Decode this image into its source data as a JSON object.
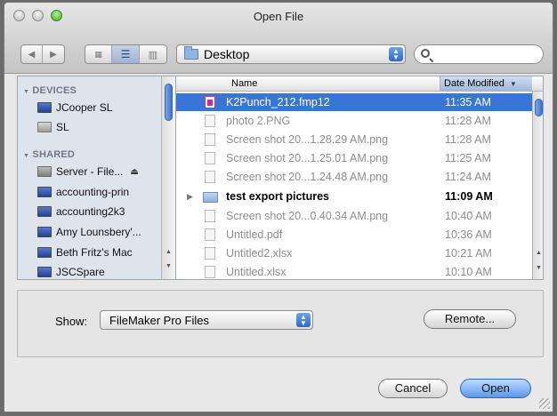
{
  "window": {
    "title": "Open File"
  },
  "toolbar": {
    "back_icon": "back-arrow-icon",
    "forward_icon": "forward-arrow-icon",
    "view_modes": [
      "icon-view-icon",
      "list-view-icon",
      "column-view-icon"
    ],
    "active_view": "list",
    "location": "Desktop",
    "search_value": ""
  },
  "sidebar": {
    "devices_label": "DEVICES",
    "shared_label": "SHARED",
    "devices": [
      {
        "label": "JCooper SL",
        "icon": "computer-icon"
      },
      {
        "label": "SL",
        "icon": "hard-drive-icon"
      }
    ],
    "shared": [
      {
        "label": "Server - File...",
        "icon": "server-icon",
        "eject": "⏏"
      },
      {
        "label": "accounting-prin",
        "icon": "monitor-icon"
      },
      {
        "label": "accounting2k3",
        "icon": "monitor-icon"
      },
      {
        "label": "Amy Lounsbery'...",
        "icon": "computer-icon"
      },
      {
        "label": "Beth Fritz's Mac",
        "icon": "computer-icon"
      },
      {
        "label": "JSCSpare",
        "icon": "computer-icon"
      }
    ]
  },
  "filelist": {
    "columns": {
      "name": "Name",
      "date": "Date Modified"
    },
    "rows": [
      {
        "name": "K2Punch_212.fmp12",
        "date": "11:35 AM",
        "kind": "fm",
        "selected": true
      },
      {
        "name": "photo 2.PNG",
        "date": "11:28 AM",
        "kind": "file",
        "dim": true
      },
      {
        "name": "Screen shot 20...1.28.29 AM.png",
        "date": "11:28 AM",
        "kind": "file",
        "dim": true
      },
      {
        "name": "Screen shot 20...1.25.01 AM.png",
        "date": "11:25 AM",
        "kind": "file",
        "dim": true
      },
      {
        "name": "Screen shot 20...1.24.48 AM.png",
        "date": "11:24 AM",
        "kind": "file",
        "dim": true
      },
      {
        "name": "test export pictures",
        "date": "11:09 AM",
        "kind": "folder",
        "bold": true
      },
      {
        "name": "Screen shot 20...0.40.34 AM.png",
        "date": "10:40 AM",
        "kind": "file",
        "dim": true
      },
      {
        "name": "Untitled.pdf",
        "date": "10:36 AM",
        "kind": "file",
        "dim": true
      },
      {
        "name": "Untitled2.xlsx",
        "date": "10:21 AM",
        "kind": "file",
        "dim": true
      },
      {
        "name": "Untitled.xlsx",
        "date": "10:10 AM",
        "kind": "file",
        "dim": true
      }
    ]
  },
  "options": {
    "show_label": "Show:",
    "show_value": "FileMaker Pro Files",
    "remote_label": "Remote..."
  },
  "actions": {
    "cancel_label": "Cancel",
    "open_label": "Open"
  },
  "colors": {
    "selection": "#3875d7",
    "sidebar_bg": "#dee4ec",
    "default_button": "#5a98ea"
  }
}
